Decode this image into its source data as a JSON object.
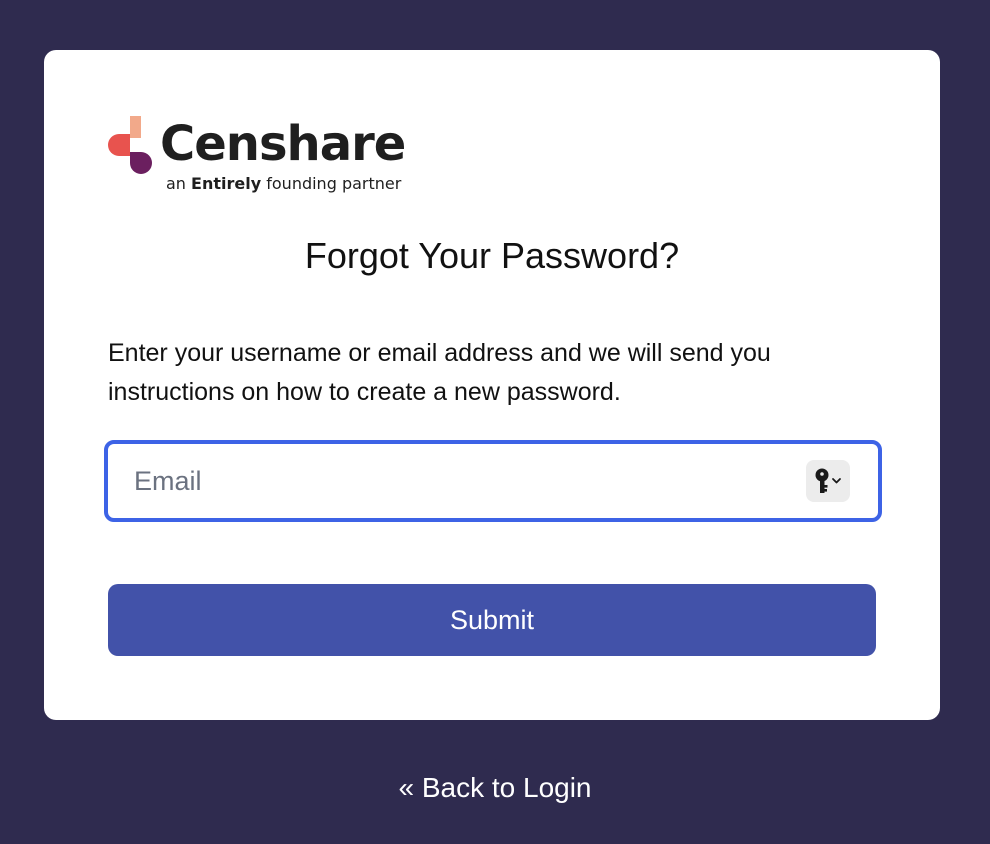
{
  "brand": {
    "name": "Censhare",
    "tagline_prefix": "an",
    "tagline_bold": "Entirely",
    "tagline_suffix": "founding partner",
    "colors": {
      "mark_top": "#f2a98a",
      "mark_left": "#e8534e",
      "mark_bottom": "#6b1f5f"
    }
  },
  "page": {
    "title": "Forgot Your Password?",
    "description": "Enter your username or email address and we will send you instructions on how to create a new password."
  },
  "form": {
    "email": {
      "placeholder": "Email",
      "value": ""
    },
    "password_manager_icon": "key-icon",
    "submit_label": "Submit"
  },
  "footer": {
    "back_link_label": "« Back to Login"
  },
  "colors": {
    "background": "#2f2b4f",
    "card": "#ffffff",
    "accent": "#3d63e6",
    "submit": "#4252a9"
  }
}
